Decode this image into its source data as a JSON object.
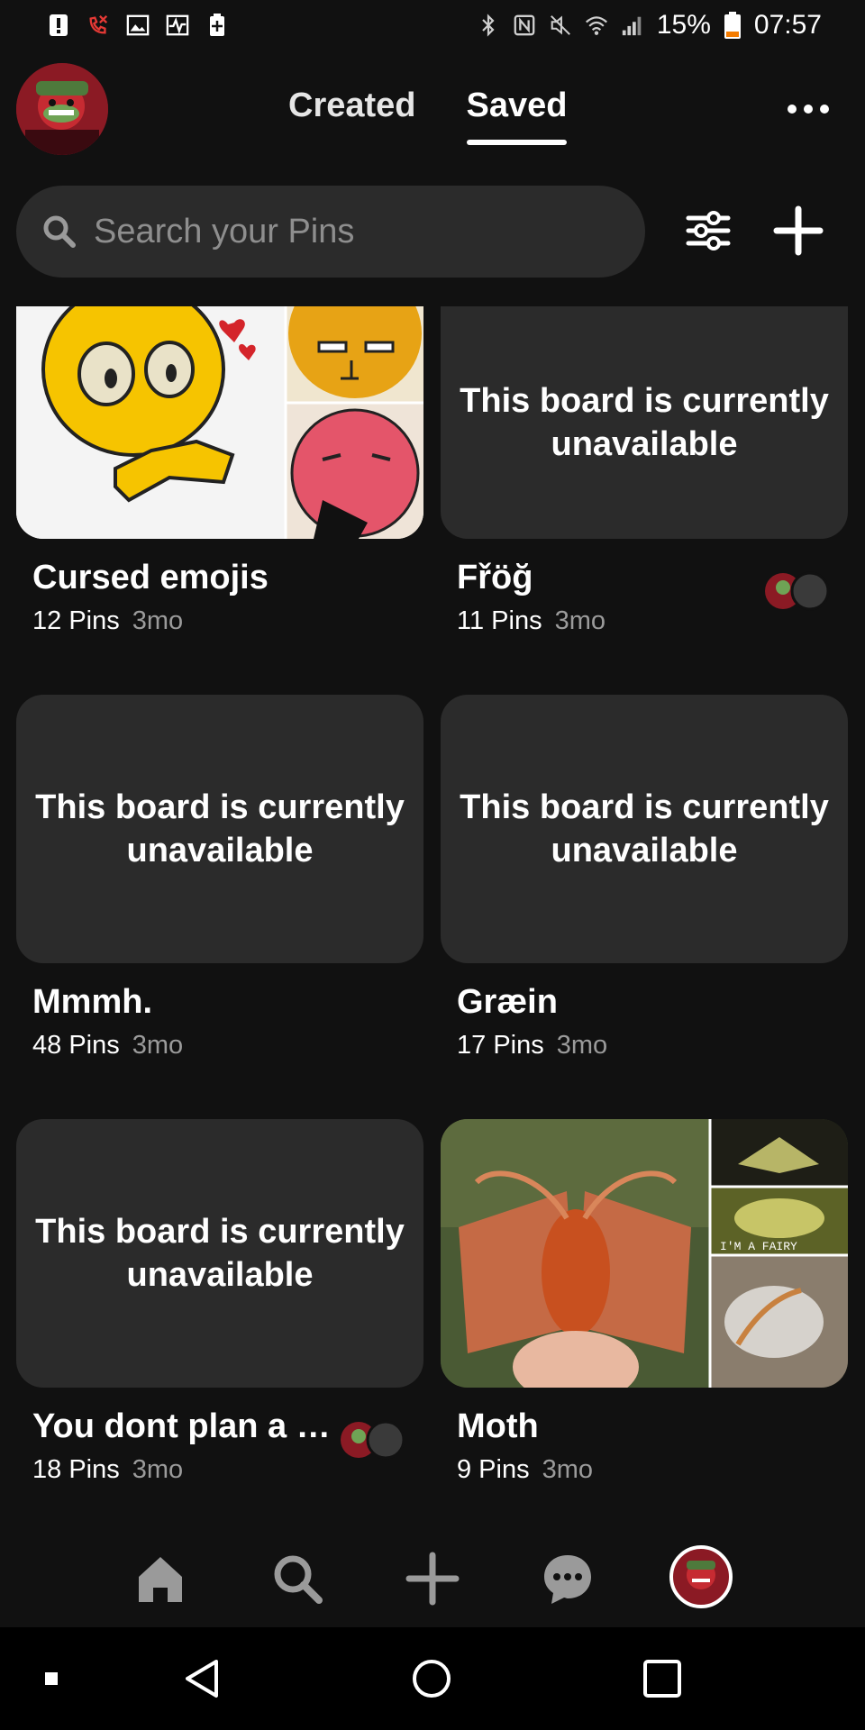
{
  "status_bar": {
    "battery_percent": "15%",
    "time": "07:57"
  },
  "header": {
    "tabs": [
      {
        "label": "Created",
        "active": false
      },
      {
        "label": "Saved",
        "active": true
      }
    ]
  },
  "search": {
    "placeholder": "Search your Pins"
  },
  "boards": [
    {
      "name": "Cursed emojis",
      "pins": "12 Pins",
      "age": "3mo"
    },
    {
      "name": "Fřöğ",
      "pins": "11 Pins",
      "age": "3mo",
      "unavailable_text": "This board is currently unavailable"
    },
    {
      "name": "Mmmh.",
      "pins": "48 Pins",
      "age": "3mo",
      "unavailable_text": "This board is currently unavailable"
    },
    {
      "name": "Græin",
      "pins": "17 Pins",
      "age": "3mo",
      "unavailable_text": "This board is currently unavailable"
    },
    {
      "name": "You dont plan a …",
      "pins": "18 Pins",
      "age": "3mo",
      "unavailable_text": "This board is currently unavailable"
    },
    {
      "name": "Moth",
      "pins": "9 Pins",
      "age": "3mo",
      "image_caption": "I'M A FAIRY"
    }
  ],
  "colors": {
    "background": "#111111",
    "card": "#2b2b2b",
    "battery_low": "#f57c00"
  }
}
